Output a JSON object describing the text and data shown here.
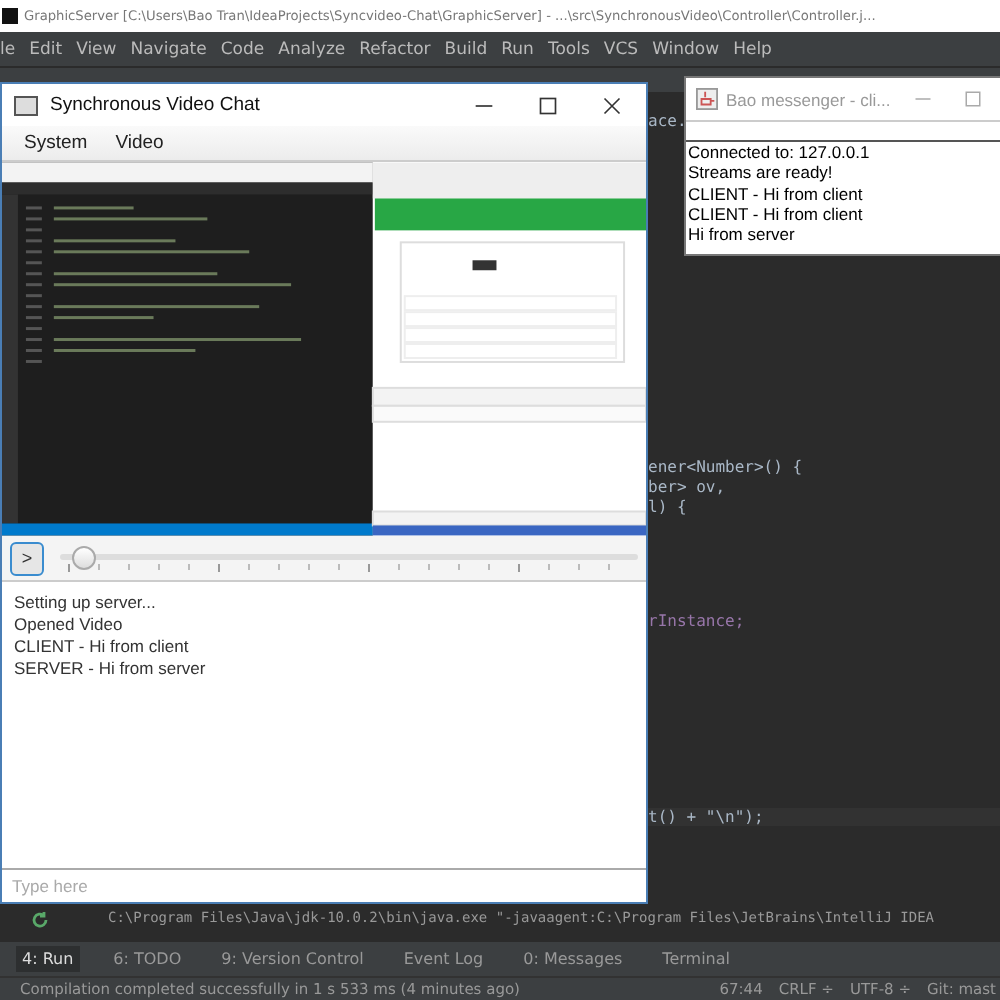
{
  "ide": {
    "title": "GraphicServer [C:\\Users\\Bao Tran\\IdeaProjects\\Syncvideo-Chat\\GraphicServer] - ...\\src\\SynchronousVideo\\Controller\\Controller.j...",
    "menu": [
      "le",
      "Edit",
      "View",
      "Navigate",
      "Code",
      "Analyze",
      "Refactor",
      "Build",
      "Run",
      "Tools",
      "VCS",
      "Window",
      "Help"
    ],
    "code_lines": [
      {
        "text": "ace.",
        "kind": "plain"
      },
      {
        "text": "ener<Number>() {",
        "kind": "plain"
      },
      {
        "text": "ber> ov,",
        "kind": "plain"
      },
      {
        "text": "l) {",
        "kind": "plain"
      },
      {
        "text": "rInstance;",
        "kind": "field"
      },
      {
        "text": "t() + \"\\n\");",
        "kind": "plain"
      }
    ],
    "console_line": "C:\\Program Files\\Java\\jdk-10.0.2\\bin\\java.exe \"-javaagent:C:\\Program Files\\JetBrains\\IntelliJ IDEA",
    "tool_tabs": [
      {
        "label": "4: Run",
        "selected": true
      },
      {
        "label": "6: TODO",
        "selected": false
      },
      {
        "label": "9: Version Control",
        "selected": false
      },
      {
        "label": "Event Log",
        "selected": false
      },
      {
        "label": "0: Messages",
        "selected": false
      },
      {
        "label": "Terminal",
        "selected": false
      }
    ],
    "status_bar": {
      "message": "Compilation completed successfully in 1 s 533 ms (4 minutes ago)",
      "position": "67:44",
      "line_separator": "CRLF ÷",
      "encoding": "UTF-8 ÷",
      "vcs": "Git: mast"
    }
  },
  "chat_window": {
    "title": "Synchronous Video Chat",
    "menu": [
      "System",
      "Video"
    ],
    "playback": {
      "play_label": ">",
      "level": 0.02
    },
    "log": [
      "Setting up server...",
      "Opened Video",
      "CLIENT - Hi from client",
      "SERVER - Hi from server"
    ],
    "input": {
      "placeholder": "Type here"
    }
  },
  "messenger_window": {
    "title": "Bao messenger - cli...",
    "log": [
      "Connected to: 127.0.0.1",
      "Streams are ready!",
      "CLIENT - Hi from client",
      "CLIENT - Hi from client",
      "Hi from server"
    ]
  }
}
